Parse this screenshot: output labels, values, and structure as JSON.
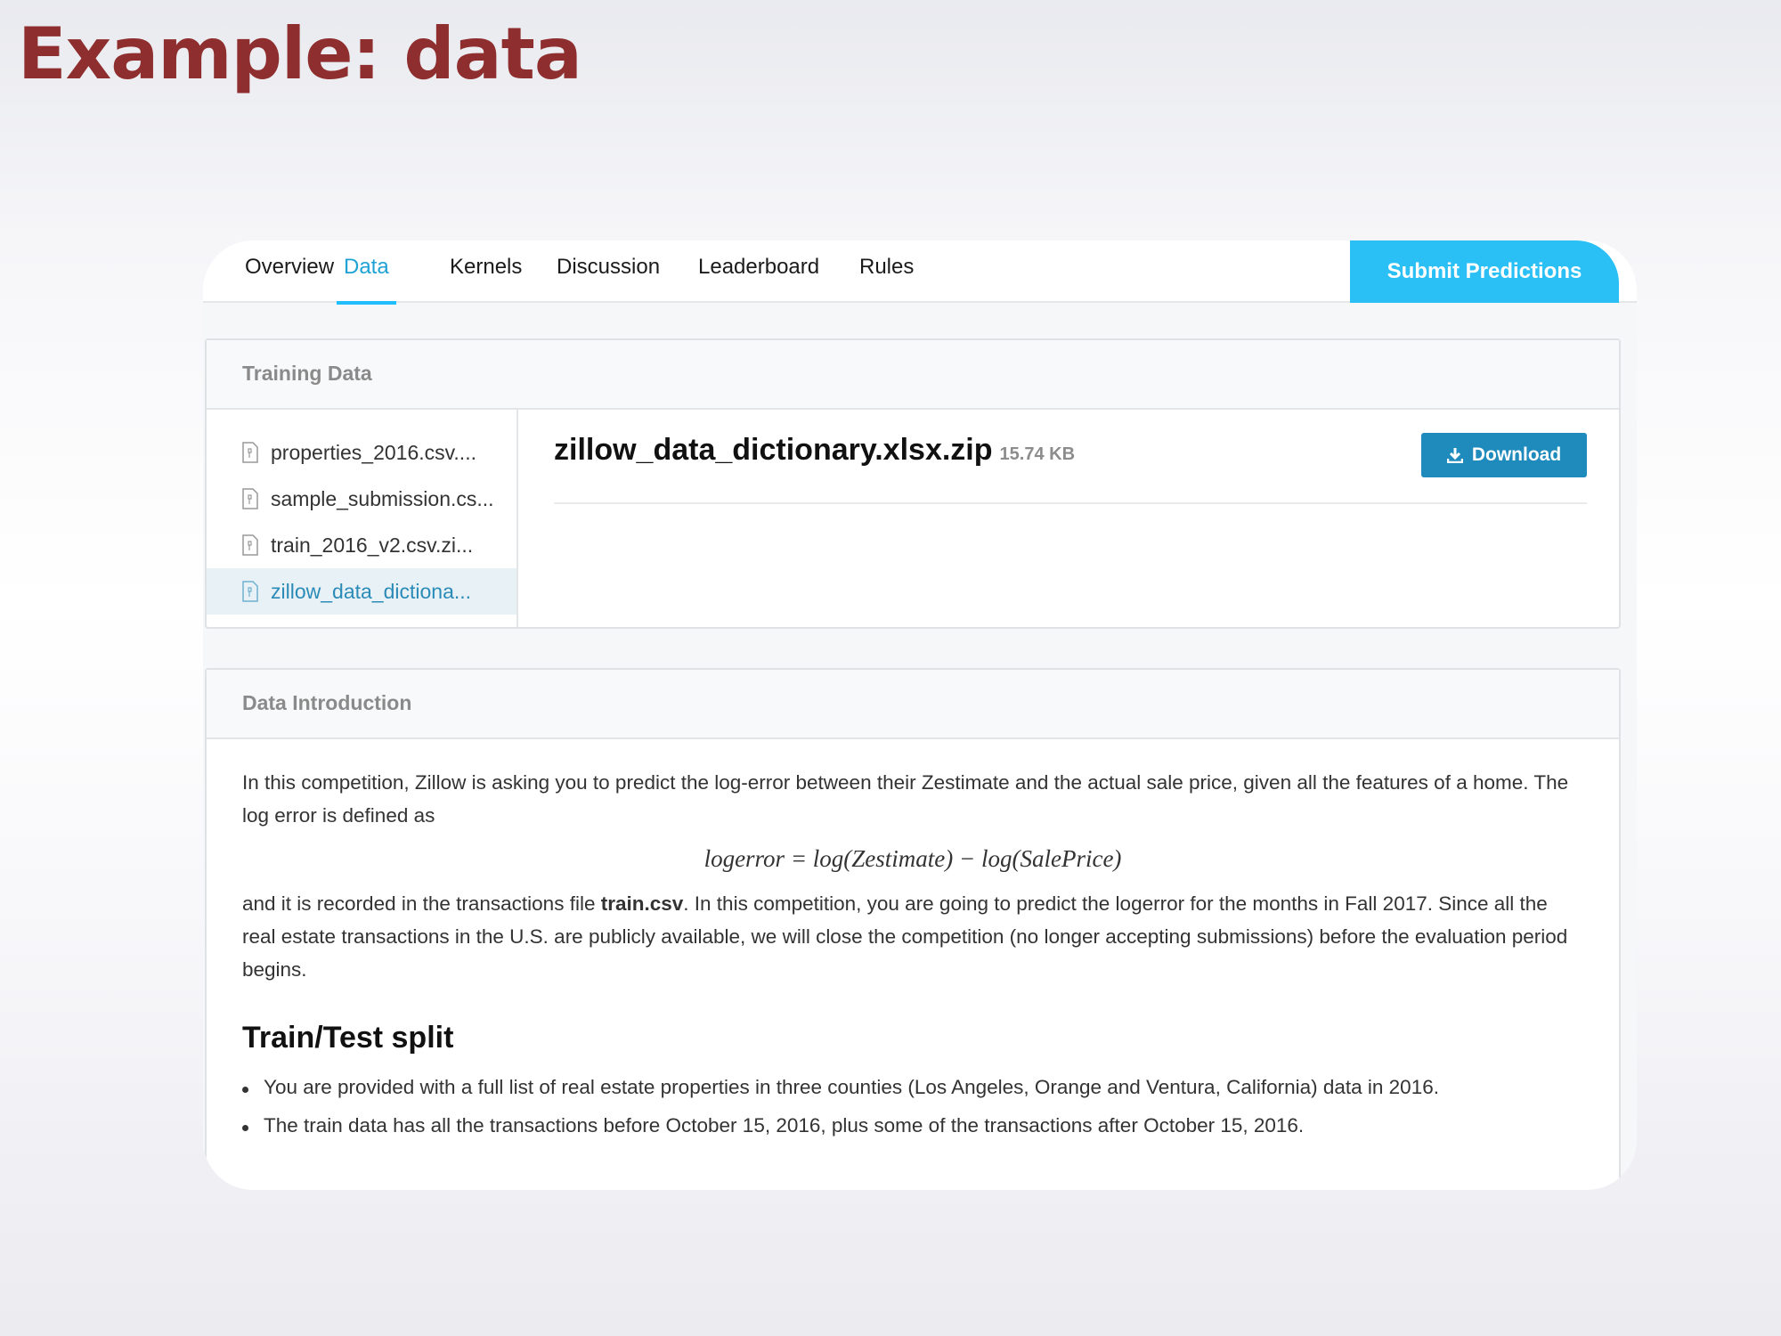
{
  "slide_title": "Example: data",
  "nav": {
    "tabs": [
      {
        "label": "Overview"
      },
      {
        "label": "Data"
      },
      {
        "label": "Kernels"
      },
      {
        "label": "Discussion"
      },
      {
        "label": "Leaderboard"
      },
      {
        "label": "Rules"
      }
    ],
    "active_tab": "Data",
    "submit_label": "Submit Predictions"
  },
  "training_data": {
    "header": "Training Data",
    "files": [
      {
        "name": "properties_2016.csv...."
      },
      {
        "name": "sample_submission.cs..."
      },
      {
        "name": "train_2016_v2.csv.zi..."
      },
      {
        "name": "zillow_data_dictiona..."
      }
    ],
    "selected_file": {
      "name": "zillow_data_dictionary.xlsx.zip",
      "size": "15.74 KB"
    },
    "download_label": "Download"
  },
  "data_introduction": {
    "header": "Data Introduction",
    "paragraph1": "In this competition, Zillow is asking you to predict the log-error between their Zestimate and the actual sale price, given all the features of a home. The log error is defined as",
    "formula": "logerror = log(Zestimate) − log(SalePrice)",
    "paragraph2_before": "and it is recorded in the transactions file ",
    "paragraph2_bold": "train.csv",
    "paragraph2_after": ". In this competition, you are going to predict the logerror for the months in Fall 2017. Since all the real estate transactions in the U.S. are publicly available, we will close the competition (no longer accepting submissions) before the evaluation period begins.",
    "section_title": "Train/Test split",
    "bullets": [
      "You are provided with a full list of real estate properties in three counties (Los Angeles, Orange and Ventura, California) data in 2016.",
      "The train data has all the transactions before October 15, 2016, plus some of the transactions after October 15, 2016."
    ]
  },
  "colors": {
    "title": "#8e2e2e",
    "accent": "#20beff",
    "submit_bg": "#2ac0f6",
    "download_bg": "#1f8bbd"
  }
}
